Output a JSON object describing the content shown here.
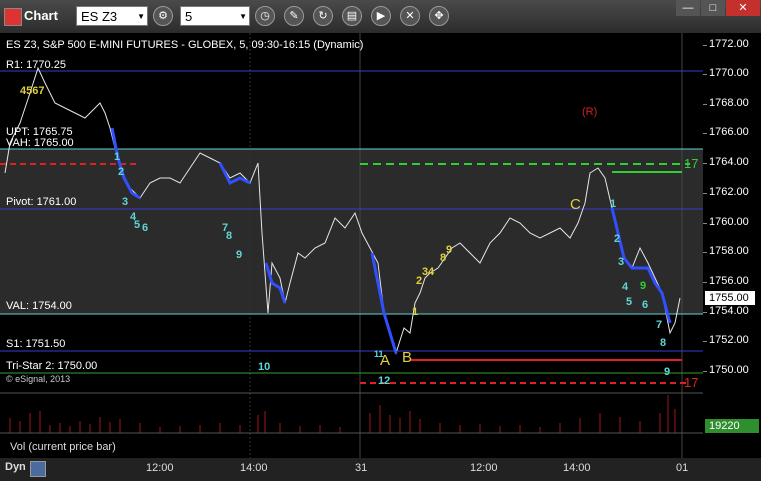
{
  "window": {
    "title": "Chart",
    "close_glyph": "✕",
    "minimize_glyph": "—",
    "restore_glyph": "□"
  },
  "toolbar": {
    "symbol": "ES Z3",
    "interval": "5",
    "dropdown_glyph": "▼",
    "tools": [
      "gear-icon",
      "clock-icon",
      "pencil-icon",
      "refresh-icon",
      "properties-icon",
      "play-icon",
      "remove-icon",
      "move-icon"
    ]
  },
  "chart": {
    "header": "ES Z3, S&P 500 E-MINI FUTURES - GLOBEX, 5, 09:30-16:15 (Dynamic)",
    "copyright": "© eSignal, 2013",
    "levels": {
      "r1": "R1: 1770.25",
      "upt": "UPT: 1765.75",
      "vah": "VAH: 1765.00",
      "pivot": "Pivot: 1761.00",
      "val": "VAL: 1754.00",
      "s1": "S1: 1751.50",
      "tristar": "Tri-Star 2: 1750.00"
    },
    "markers": {
      "a": "A",
      "b": "B",
      "c": "C",
      "r": "(R)",
      "n10": "10",
      "n12": "12",
      "n11": "11",
      "n9": "9",
      "n17_right": "17",
      "n17_left": "17",
      "seq_left_1": "1",
      "seq_left_2": "2",
      "seq_left_3": "3",
      "seq_left_4": "4",
      "seq_left_5": "5",
      "seq_left_6": "6",
      "seq_mid_7": "7",
      "seq_mid_8": "8",
      "seq_mid_9": "9",
      "seq_right_1": "1",
      "seq_right_2": "2",
      "seq_right_3": "3",
      "seq_right_4": "4",
      "seq_right_5": "5",
      "seq_right_6": "6",
      "seq_right_7": "7",
      "seq_right_8": "8",
      "seq_right_9": "9",
      "seq_b_1": "1",
      "seq_b_2": "2",
      "seq_b_3": "3",
      "seq_b_4": "4",
      "seq_b_8": "8",
      "seq_b_9": "9",
      "top_seq": "4567",
      "green_2": "2",
      "green_3": "3"
    },
    "last_price": "1755.00",
    "vol_label": "Vol (current price bar)",
    "vol_value": "19220",
    "bottom_label": "Dyn"
  },
  "price_axis": {
    "ticks": [
      "1772.00",
      "1770.00",
      "1768.00",
      "1766.00",
      "1764.00",
      "1762.00",
      "1760.00",
      "1758.00",
      "1756.00",
      "1754.00",
      "1752.00",
      "1750.00"
    ]
  },
  "time_axis": {
    "labels": [
      "12:00",
      "14:00",
      "31",
      "12:00",
      "14:00",
      "01"
    ]
  }
}
